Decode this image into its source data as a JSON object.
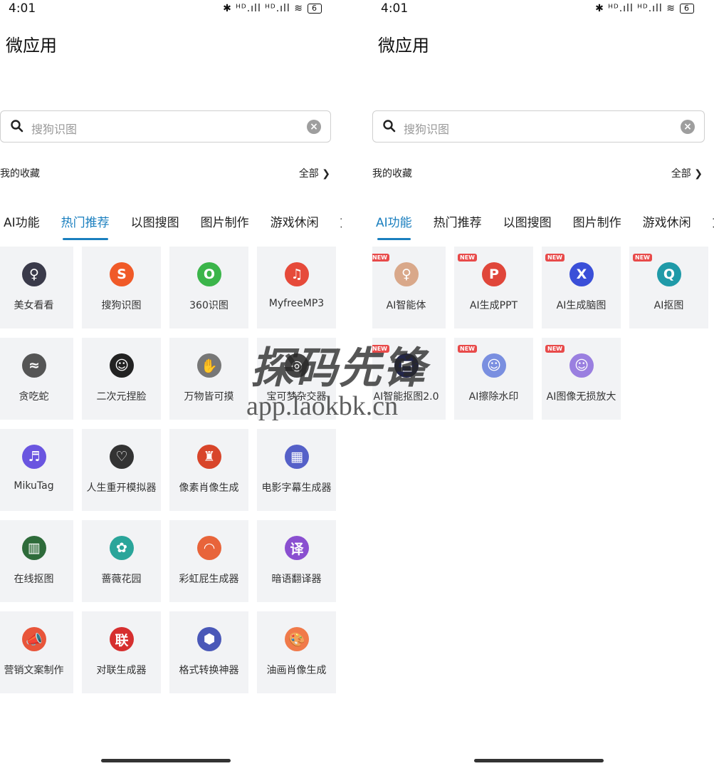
{
  "screens": [
    {
      "status": {
        "time": "4:01",
        "battery": "6",
        "signal": "✱ ᴴᴰ.ıll ᴴᴰ.ıll ≋"
      },
      "title": "微应用",
      "search": {
        "placeholder": "搜狗识图"
      },
      "favorites": {
        "label": "我的收藏",
        "all": "全部 ❯"
      },
      "tabs": [
        "AI功能",
        "热门推荐",
        "以图搜图",
        "图片制作",
        "游戏休闲",
        "文"
      ],
      "active_tab": 1,
      "apps": [
        {
          "label": "美女看看",
          "icon": "avatar-girl-icon",
          "glyph": "♀",
          "color": "#3a3a4a",
          "new": false
        },
        {
          "label": "搜狗识图",
          "icon": "sogou-icon",
          "glyph": "S",
          "color": "#f05a28",
          "new": false
        },
        {
          "label": "360识图",
          "icon": "360-icon",
          "glyph": "O",
          "color": "#3bb54a",
          "new": false
        },
        {
          "label": "MyfreeMP3",
          "icon": "music-note-icon",
          "glyph": "♫",
          "color": "#e64a3a",
          "new": false
        },
        {
          "label": "贪吃蛇",
          "icon": "snake-icon",
          "glyph": "≈",
          "color": "#555555",
          "new": false
        },
        {
          "label": "二次元捏脸",
          "icon": "anime-face-icon",
          "glyph": "☺",
          "color": "#222222",
          "new": false
        },
        {
          "label": "万物皆可摸",
          "icon": "hand-icon",
          "glyph": "✋",
          "color": "#777777",
          "new": false
        },
        {
          "label": "宝可梦杂交器",
          "icon": "pokeball-icon",
          "glyph": "◎",
          "color": "#444444",
          "new": false
        },
        {
          "label": "MikuTag",
          "icon": "headphones-icon",
          "glyph": "♬",
          "color": "#6a55e0",
          "new": false
        },
        {
          "label": "人生重开模拟器",
          "icon": "head-heart-icon",
          "glyph": "♡",
          "color": "#333333",
          "new": false
        },
        {
          "label": "像素肖像生成",
          "icon": "pixel-mario-icon",
          "glyph": "♜",
          "color": "#d8452a",
          "new": false
        },
        {
          "label": "电影字幕生成器",
          "icon": "film-strip-icon",
          "glyph": "▦",
          "color": "#5560c8",
          "new": false
        },
        {
          "label": "在线抠图",
          "icon": "qr-bars-icon",
          "glyph": "▥",
          "color": "#2e6b3a",
          "new": false
        },
        {
          "label": "蔷薇花园",
          "icon": "garden-icon",
          "glyph": "✿",
          "color": "#2aa59a",
          "new": false
        },
        {
          "label": "彩虹屁生成器",
          "icon": "rainbow-icon",
          "glyph": "◠",
          "color": "#e8643a",
          "new": false
        },
        {
          "label": "暗语翻译器",
          "icon": "translate-icon",
          "glyph": "译",
          "color": "#8a4fd0",
          "new": false
        },
        {
          "label": "营销文案制作",
          "icon": "megaphone-icon",
          "glyph": "📣",
          "color": "#e8553a",
          "new": false
        },
        {
          "label": "对联生成器",
          "icon": "couplet-icon",
          "glyph": "联",
          "color": "#d62f2f",
          "new": false
        },
        {
          "label": "格式转换神器",
          "icon": "cube-convert-icon",
          "glyph": "⬢",
          "color": "#4a58b8",
          "new": false
        },
        {
          "label": "油画肖像生成",
          "icon": "palette-icon",
          "glyph": "🎨",
          "color": "#f07a4a",
          "new": false
        }
      ]
    },
    {
      "status": {
        "time": "4:01",
        "battery": "6",
        "signal": "✱ ᴴᴰ.ıll ᴴᴰ.ıll ≋"
      },
      "title": "微应用",
      "search": {
        "placeholder": "搜狗识图"
      },
      "favorites": {
        "label": "我的收藏",
        "all": "全部 ❯"
      },
      "tabs": [
        "AI功能",
        "热门推荐",
        "以图搜图",
        "图片制作",
        "游戏休闲",
        "文"
      ],
      "active_tab": 0,
      "apps": [
        {
          "label": "AI智能体",
          "icon": "ai-avatar-icon",
          "glyph": "♀",
          "color": "#d9a88a",
          "new": true
        },
        {
          "label": "AI生成PPT",
          "icon": "ppt-icon",
          "glyph": "P",
          "color": "#e0463a",
          "new": true
        },
        {
          "label": "AI生成脑图",
          "icon": "mindmap-icon",
          "glyph": "X",
          "color": "#3a4fd8",
          "new": true
        },
        {
          "label": "AI抠图",
          "icon": "cutout-icon",
          "glyph": "Q",
          "color": "#1f9aa8",
          "new": true
        },
        {
          "label": "AI智能抠图2.0",
          "icon": "cutout-v2-icon",
          "glyph": "⬒",
          "color": "#22264a",
          "new": true
        },
        {
          "label": "AI擦除水印",
          "icon": "erase-watermark-icon",
          "glyph": "☺",
          "color": "#7a8fe0",
          "new": true
        },
        {
          "label": "AI图像无损放大",
          "icon": "upscale-icon",
          "glyph": "☺",
          "color": "#9a7fe0",
          "new": true
        }
      ]
    }
  ],
  "new_badge": "NEW",
  "watermark": {
    "title": "探码先锋",
    "url": "app.laokbk.cn"
  }
}
